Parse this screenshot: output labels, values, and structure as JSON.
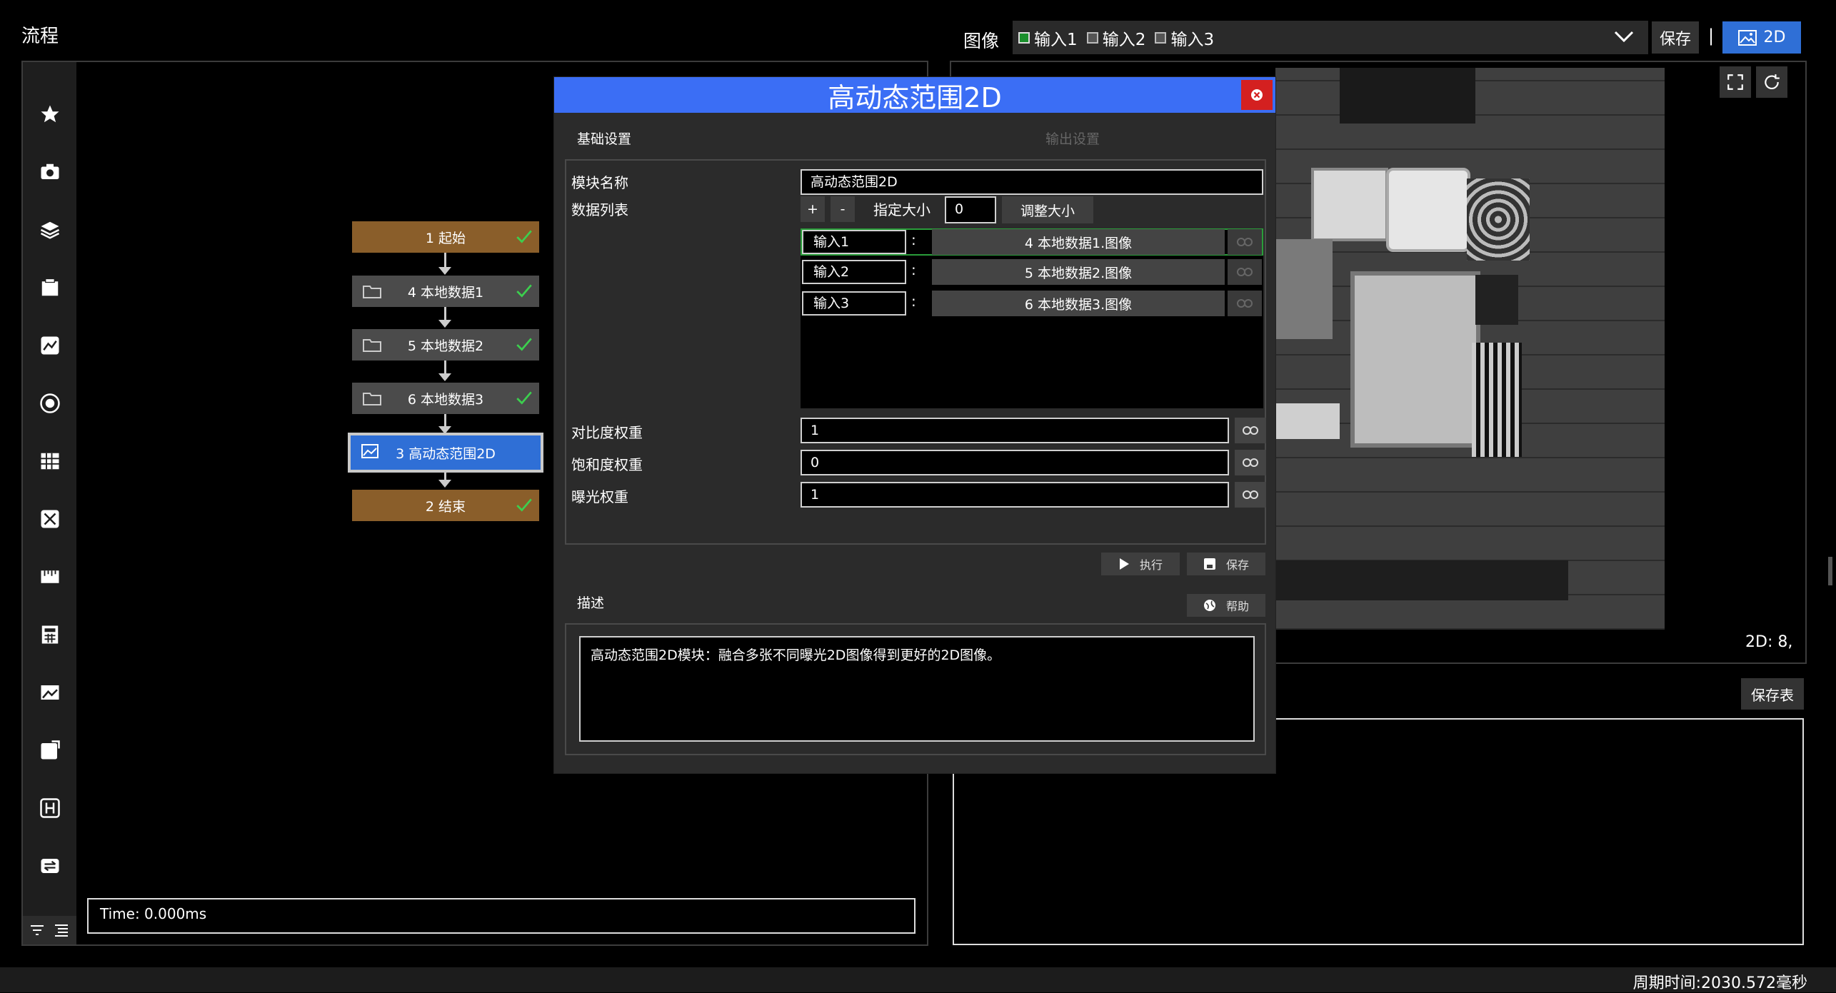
{
  "header": {
    "flow_title": "流程",
    "image_label": "图像",
    "inputs": [
      {
        "label": "输入1",
        "checked": true
      },
      {
        "label": "输入2",
        "checked": false
      },
      {
        "label": "输入3",
        "checked": false
      }
    ],
    "save_label": "保存",
    "separator": "|",
    "view_2d_label": "2D"
  },
  "sidebar": {
    "icons": [
      "star-icon",
      "camera-icon",
      "layers-icon",
      "clipboard-icon",
      "image-edit-icon",
      "target-icon",
      "grid-icon",
      "calibrate-icon",
      "ruler-icon",
      "calculator-icon",
      "picture-icon",
      "export-icon",
      "interface-icon",
      "transfer-icon"
    ]
  },
  "flow": {
    "nodes": [
      {
        "label": "1 起始",
        "kind": "brown"
      },
      {
        "label": "4 本地数据1",
        "kind": "gray"
      },
      {
        "label": "5 本地数据2",
        "kind": "gray"
      },
      {
        "label": "6 本地数据3",
        "kind": "gray"
      },
      {
        "label": "3 高动态范围2D",
        "kind": "selected"
      },
      {
        "label": "2 结束",
        "kind": "brown"
      }
    ],
    "time_text": "Time: 0.000ms"
  },
  "image_panel": {
    "coord_text": "2D: 8,",
    "save_table_label": "保存表"
  },
  "status_bar": {
    "cycle_time": "周期时间:2030.572毫秒"
  },
  "dialog": {
    "title": "高动态范围2D",
    "tab_basic": "基础设置",
    "tab_output": "输出设置",
    "module_name_label": "模块名称",
    "module_name_value": "高动态范围2D",
    "data_list_label": "数据列表",
    "plus_label": "+",
    "minus_label": "-",
    "size_label": "指定大小",
    "size_value": "0",
    "resize_label": "调整大小",
    "rows": [
      {
        "name": "输入1",
        "value": "4 本地数据1.图像"
      },
      {
        "name": "输入2",
        "value": "5 本地数据2.图像"
      },
      {
        "name": "输入3",
        "value": "6 本地数据3.图像"
      }
    ],
    "colon": ":",
    "contrast_label": "对比度权重",
    "contrast_value": "1",
    "saturation_label": "饱和度权重",
    "saturation_value": "0",
    "exposure_label": "曝光权重",
    "exposure_value": "1",
    "run_label": "执行",
    "save_label": "保存",
    "desc_label": "描述",
    "help_label": "帮助",
    "description": "高动态范围2D模块：融合多张不同曝光2D图像得到更好的2D图像。"
  },
  "colors": {
    "accent_blue": "#3b6ef5",
    "node_brown": "#8a5e2a",
    "check_green": "#3ccf4e",
    "close_red": "#d42020"
  }
}
